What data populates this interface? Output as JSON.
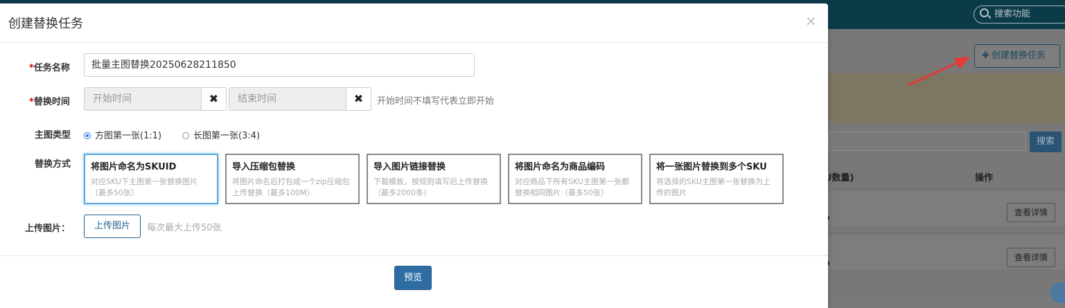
{
  "background": {
    "search_placeholder": "搜索功能",
    "create_button": "创建替换任务",
    "search_button": "搜索",
    "table_headers": [
      "U数量)",
      "操作"
    ],
    "rows": [
      {
        "action": "查看详情"
      },
      {
        "action": "查看详情"
      }
    ]
  },
  "modal": {
    "title": "创建替换任务",
    "close_symbol": "×",
    "fields": {
      "task_name": {
        "label": "任务名称",
        "value": "批量主图替换20250628211850"
      },
      "time": {
        "label": "替换时间",
        "start_placeholder": "开始时间",
        "end_placeholder": "结束时间",
        "hint": "开始时间不填写代表立即开始"
      },
      "image_type": {
        "label": "主图类型",
        "options": [
          {
            "label": "方图第一张(1:1)",
            "selected": true
          },
          {
            "label": "长图第一张(3:4)",
            "selected": false
          }
        ]
      },
      "method": {
        "label": "替换方式",
        "options": [
          {
            "title": "将图片命名为SKUID",
            "desc": "对应SKU下主图第一张替换图片（最多50张）",
            "selected": true
          },
          {
            "title": "导入压缩包替换",
            "desc": "将图片命名后打包成一个zip压缩包上传替换（最多100M）",
            "selected": false
          },
          {
            "title": "导入图片链接替换",
            "desc": "下载模板，按规则填写后上传替换（最多2000条）",
            "selected": false
          },
          {
            "title": "将图片命名为商品编码",
            "desc": "对应商品下所有SKU主图第一张都替换相同图片（最多50张）",
            "selected": false
          },
          {
            "title": "将一张图片替换到多个SKU",
            "desc": "将选择的SKU主图第一张替换为上传的图片",
            "selected": false
          }
        ]
      },
      "upload": {
        "label": "上传图片：",
        "button": "上传图片",
        "hint": "每次最大上传50张"
      }
    },
    "required_mark": "*",
    "clear_symbol": "✖",
    "preview_button": "预览"
  },
  "colors": {
    "primary": "#2e6da4",
    "required": "#cc0000",
    "selected_card_border": "#5aa8d8",
    "annotation_arrow": "#e53935"
  }
}
